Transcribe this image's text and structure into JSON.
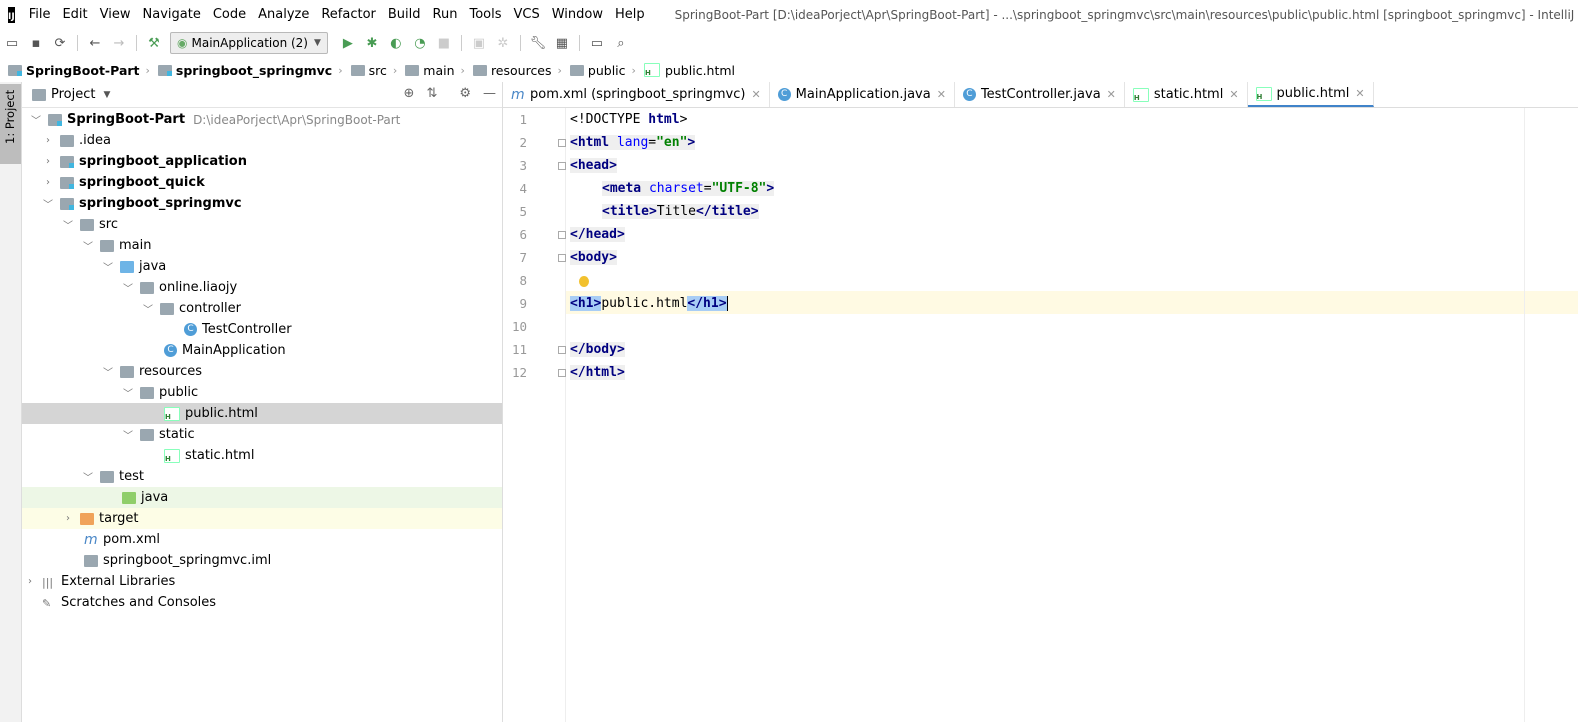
{
  "app_logo": "IJ",
  "menu": [
    "File",
    "Edit",
    "View",
    "Navigate",
    "Code",
    "Analyze",
    "Refactor",
    "Build",
    "Run",
    "Tools",
    "VCS",
    "Window",
    "Help"
  ],
  "window_title": "SpringBoot-Part [D:\\ideaPorject\\Apr\\SpringBoot-Part] - ...\\springboot_springmvc\\src\\main\\resources\\public\\public.html [springboot_springmvc] - IntelliJ IDEA",
  "toolbar": {
    "run_config": "MainApplication (2)"
  },
  "breadcrumb": [
    "SpringBoot-Part",
    "springboot_springmvc",
    "src",
    "main",
    "resources",
    "public",
    "public.html"
  ],
  "left_stripe": {
    "project_tab": "1: Project"
  },
  "project_panel": {
    "title": "Project"
  },
  "tree": [
    {
      "label": "SpringBoot-Part",
      "hint": "D:\\ideaPorject\\Apr\\SpringBoot-Part"
    },
    {
      "label": ".idea"
    },
    {
      "label": "springboot_application"
    },
    {
      "label": "springboot_quick"
    },
    {
      "label": "springboot_springmvc"
    },
    {
      "label": "src"
    },
    {
      "label": "main"
    },
    {
      "label": "java"
    },
    {
      "label": "online.liaojy"
    },
    {
      "label": "controller"
    },
    {
      "label": "TestController"
    },
    {
      "label": "MainApplication"
    },
    {
      "label": "resources"
    },
    {
      "label": "public"
    },
    {
      "label": "public.html"
    },
    {
      "label": "static"
    },
    {
      "label": "static.html"
    },
    {
      "label": "test"
    },
    {
      "label": "java"
    },
    {
      "label": "target"
    },
    {
      "label": "pom.xml"
    },
    {
      "label": "springboot_springmvc.iml"
    },
    {
      "label": "External Libraries"
    },
    {
      "label": "Scratches and Consoles"
    }
  ],
  "editor_tabs": [
    {
      "label": "pom.xml (springboot_springmvc)"
    },
    {
      "label": "MainApplication.java"
    },
    {
      "label": "TestController.java"
    },
    {
      "label": "static.html"
    },
    {
      "label": "public.html"
    }
  ],
  "code": {
    "line_numbers": [
      "1",
      "2",
      "3",
      "4",
      "5",
      "6",
      "7",
      "8",
      "9",
      "10",
      "11",
      "12"
    ],
    "l1": {
      "a": "<!DOCTYPE ",
      "b": "html",
      "c": ">"
    },
    "l2": {
      "a": "<html ",
      "b": "lang",
      "c": "=",
      "d": "\"en\"",
      "e": ">"
    },
    "l3": "<head>",
    "l4": {
      "a": "<meta ",
      "b": "charset",
      "c": "=",
      "d": "\"UTF-8\"",
      "e": ">"
    },
    "l5": {
      "a": "<title>",
      "b": "Title",
      "c": "</title>"
    },
    "l6": "</head>",
    "l7": "<body>",
    "l9": {
      "a": "<h1>",
      "b": "public.html",
      "c": "</h1>"
    },
    "l11": "</body>",
    "l12": "</html>"
  }
}
